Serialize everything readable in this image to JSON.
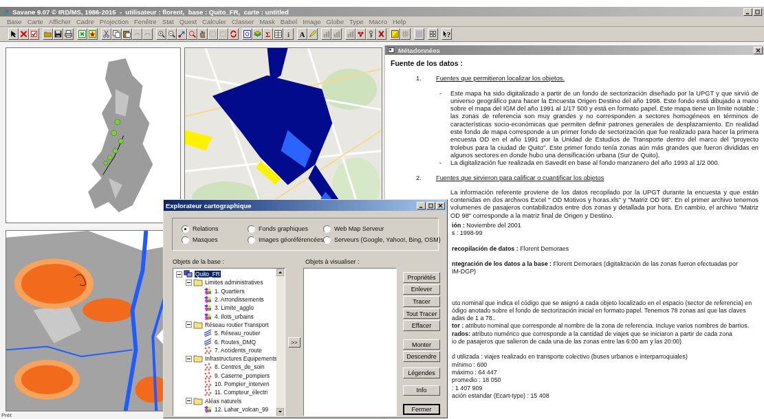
{
  "window": {
    "title": "Savane 9.07 © IRD/MS, 1986-2015  -  utilisateur : florent,  base : Quito_FR,  carte : untitled"
  },
  "menu": [
    "Base",
    "Carte",
    "Afficher",
    "Cadre",
    "Projection",
    "Fenêtre",
    "Stat",
    "Quest",
    "Calculer",
    "Classer",
    "Mask",
    "Babel",
    "Image",
    "Globe",
    "Type",
    "Macro",
    "Help"
  ],
  "toolbar_glyphs": [
    "Σ",
    "i",
    "A",
    "?"
  ],
  "metadata": {
    "title": "Métadonnées",
    "heading": "Fuente de los datos :",
    "sections": [
      {
        "number": "1.",
        "title": "Fuentes que permitieron localizar los objetos.",
        "bullets": [
          {
            "marker": "-",
            "text": "Este mapa ha sido digitalizado a partir de un fondo de sectorización diseñado por la UPGT y que sirvió de universo geográfico para hacer la Encuesta Origen Destino del año 1998. Este fondo está dibujado a mano sobre el mapa del IGM del año 1991 al 1/17 500 y está en formato papel. Este mapa tiene un límite notable : las zonas de referencia son muy grandes y no corresponden a sectores homogéneos en términos de características socio-económicas que permiten definir patrones generales de desplazamiento. En realidad este fondo de mapa corresponde a un primer fondo de sectorización que fue realizado para hacer la primera encuesta OD en el año 1991 por la Unidad de Estudios de Transporte dentro del marco del \"proyecto trolebus para la ciudad de Quito\". Este primer fondo tenía zonas aún más grandes que fueron divididas en algunos sectores en donde hubo una densificación urbana (Sur de Quito)."
          },
          {
            "marker": "-",
            "text": "La digitalización fue realizada en Savedit en base al fondo manzanero del año 1993 al 1/2 000."
          }
        ]
      },
      {
        "number": "2.",
        "title": "Fuentes que sirvieron para calificar o cuantificar los objetos",
        "bullets": [
          {
            "text": "La información referente proviene de los datos recopilado por la UPGT durante la encuesta y que están contenidas en dos archivos Excel \" OD Motivos y horas.xls\" y \"Matriz OD 98\". En el primer archivo tenemos volumenes de pasajeros contabilizados entre dos zonas y detallada por hora. En cambio, el archivo \"Matriz OD 98\" corresponde a la matriz final de Origen y Destino."
          }
        ]
      }
    ],
    "partial_blocks": [
      [
        "**ión :** Noviembre del 2001",
        "s : 1998-99"
      ],
      [
        "**recopilación de datos :** Florent Demoraes"
      ],
      [
        "**ntegración de los datos a la base :** Florent Demoraes (digitalización de las zonas fueron efectuadas por",
        "IM-DGP)"
      ],
      [
        "uto nominal que indica el código que se asignó a cada objeto localizado en el espacio (sector de referencia) en",
        "ódigo anotado sobre el fondo de sectorización inicial en formato papel. Tenemos 78 zonas así que las claves",
        "adas de 1 a 78..",
        "**tor :** atributo nominal que corresponde al nombre de la zona de referencia. Incluye varios nombres de barrios.",
        "**rados:** atributo numérico que corresponde a la cantidad de viajes que se iniciaron a partir de cada zona",
        "io de pasajeros que salieron de cada una de las zonas entre las 6:00 am y las 20:00)"
      ],
      [
        "d utilizada : viajes realizado en transporte colectivo (buses urbanos e interparroquiales)",
        "mínimo : 600",
        "máximo : 64 447",
        "promedio :  18 050",
        ": 1 407 909",
        "ación estandar (Ecart-type) :  15 408"
      ]
    ]
  },
  "explorer": {
    "title": "Explorateur cartographique",
    "sources": [
      {
        "label": "Relations",
        "selected": true
      },
      {
        "label": "Fonds graphiques",
        "selected": false
      },
      {
        "label": "Web Map Serveur",
        "selected": false
      },
      {
        "label": "Masques",
        "selected": false
      },
      {
        "label": "Images géoréférencées",
        "selected": false
      },
      {
        "label": "Serveurs (Google, Yahoo!, Bing, OSM)",
        "selected": false
      }
    ],
    "base_label": "Objets de la base :",
    "visible_label": "Objets à visualiser :",
    "tree": [
      {
        "label": "Quito_FR",
        "kind": "database",
        "selected": true,
        "expanded": true,
        "children": [
          {
            "label": "Limites administratives",
            "kind": "folder",
            "selected": false,
            "expanded": true,
            "children": [
              {
                "label": "1. Quartiers",
                "kind": "polygon",
                "selected": false
              },
              {
                "label": "2. Arrondissements",
                "kind": "polygon",
                "selected": false
              },
              {
                "label": "3. Limite_agglo",
                "kind": "polygon",
                "selected": false
              },
              {
                "label": "4. Ilots_urbains",
                "kind": "polygon",
                "selected": false
              }
            ]
          },
          {
            "label": "Réseau routier Transport",
            "kind": "folder",
            "selected": false,
            "expanded": true,
            "children": [
              {
                "label": "5. Réseau_routier",
                "kind": "line",
                "selected": false
              },
              {
                "label": "6. Routes_DMQ",
                "kind": "line",
                "selected": false
              },
              {
                "label": "7. Accidents_route",
                "kind": "point",
                "selected": false
              }
            ]
          },
          {
            "label": "Infrastructures Equipements",
            "kind": "folder",
            "selected": false,
            "expanded": true,
            "children": [
              {
                "label": "8. Centres_de_soin",
                "kind": "point",
                "selected": false
              },
              {
                "label": "9. Caserne_pompiers",
                "kind": "point",
                "selected": false
              },
              {
                "label": "10. Pompier_interven",
                "kind": "point",
                "selected": false
              },
              {
                "label": "11. Compteur_électri",
                "kind": "point",
                "selected": false
              }
            ]
          },
          {
            "label": "Aléas naturels",
            "kind": "folder",
            "selected": false,
            "expanded": true,
            "children": [
              {
                "label": "12. Lahar_volcan_99",
                "kind": "polygon",
                "selected": false
              }
            ]
          }
        ]
      }
    ],
    "add_button": ">>",
    "buttons": [
      {
        "label": "Propriétés",
        "default": false
      },
      {
        "label": "Enlever",
        "default": false
      },
      {
        "label": "Tracer",
        "default": false
      },
      {
        "label": "Tout Tracer",
        "default": false
      },
      {
        "label": "Effacer",
        "default": false
      },
      {
        "label": "Monter",
        "default": false
      },
      {
        "label": "Descendre",
        "default": false
      },
      {
        "label": "Légendes",
        "default": false
      },
      {
        "label": "Info",
        "default": false
      },
      {
        "label": "Fermer",
        "default": true
      }
    ]
  },
  "status_bar": "Prêt"
}
